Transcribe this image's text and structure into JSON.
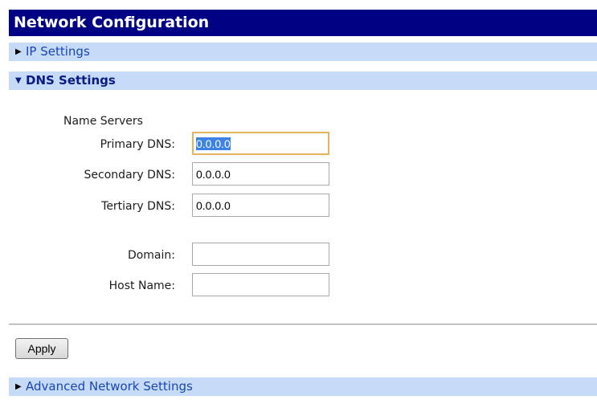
{
  "page": {
    "title": "Network Configuration"
  },
  "sections": {
    "ip_settings": {
      "label": "IP Settings",
      "state": "collapsed"
    },
    "dns_settings": {
      "label": "DNS Settings",
      "state": "expanded"
    },
    "advanced": {
      "label": "Advanced Network Settings",
      "state": "collapsed"
    }
  },
  "dns": {
    "group_label": "Name Servers",
    "primary_label": "Primary DNS:",
    "primary_value": "0.0.0.0",
    "secondary_label": "Secondary DNS:",
    "secondary_value": "0.0.0.0",
    "tertiary_label": "Tertiary DNS:",
    "tertiary_value": "0.0.0.0",
    "domain_label": "Domain:",
    "domain_value": "",
    "hostname_label": "Host Name:",
    "hostname_value": ""
  },
  "actions": {
    "apply_label": "Apply"
  },
  "icons": {
    "collapsed": "triangle-right-icon",
    "expanded": "triangle-down-icon"
  },
  "colors": {
    "title_bar": "#010183",
    "section_bar": "#c6dbf7",
    "focus_border": "#e3b45a",
    "selection": "#3e82e4"
  }
}
